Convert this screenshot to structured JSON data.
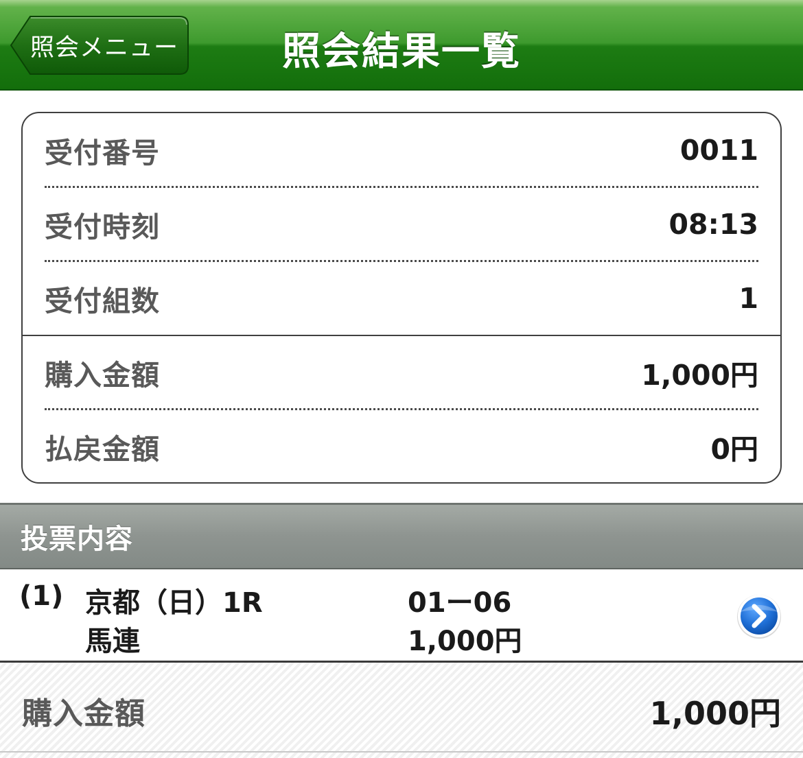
{
  "header": {
    "back_label": "照会メニュー",
    "title": "照会結果一覧"
  },
  "summary": {
    "rows": [
      {
        "label": "受付番号",
        "value": "0011"
      },
      {
        "label": "受付時刻",
        "value": "08:13"
      },
      {
        "label": "受付組数",
        "value": "1"
      },
      {
        "label": "購入金額",
        "value": "1,000円"
      },
      {
        "label": "払戻金額",
        "value": "0円"
      }
    ]
  },
  "section": {
    "title": "投票内容"
  },
  "bets": [
    {
      "index": "(1)",
      "race": "京都（日）1R",
      "type": "馬連",
      "combination": "01ー06",
      "amount": "1,000円"
    }
  ],
  "footer": {
    "label": "購入金額",
    "value": "1,000円"
  },
  "colors": {
    "header_green": "#1d7c13",
    "section_gray": "#8e9490",
    "arrow_blue": "#1f6fd6"
  },
  "icons": {
    "back": "chevron-left-button-shape",
    "detail": "chevron-right-circle-icon"
  }
}
